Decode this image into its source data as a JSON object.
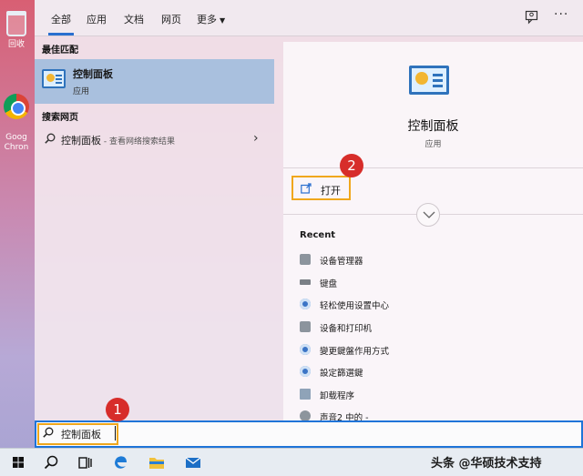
{
  "desktop": {
    "icons": [
      {
        "label": "回收",
        "icon": "recycle-bin-icon"
      },
      {
        "label": "Goog\nChron",
        "icon": "chrome-icon"
      }
    ]
  },
  "tabs": [
    {
      "label": "全部",
      "active": true
    },
    {
      "label": "应用",
      "active": false
    },
    {
      "label": "文档",
      "active": false
    },
    {
      "label": "网页",
      "active": false
    },
    {
      "label": "更多",
      "active": false
    }
  ],
  "left": {
    "best_match_heading": "最佳匹配",
    "best_match": {
      "title": "控制面板",
      "subtitle": "应用"
    },
    "web_heading": "搜索网页",
    "web_result": {
      "title": "控制面板",
      "subtitle": " - 查看网络搜索结果"
    }
  },
  "right": {
    "title": "控制面板",
    "subtitle": "应用",
    "open_label": "打开",
    "recent_heading": "Recent",
    "recent": [
      {
        "label": "设备管理器",
        "icon": "device-manager-icon"
      },
      {
        "label": "键盘",
        "icon": "keyboard-icon"
      },
      {
        "label": "轻松使用设置中心",
        "icon": "ease-of-access-icon"
      },
      {
        "label": "设备和打印机",
        "icon": "printer-icon"
      },
      {
        "label": "變更鍵盤作用方式",
        "icon": "ease-of-access-icon"
      },
      {
        "label": "設定篩選鍵",
        "icon": "ease-of-access-icon"
      },
      {
        "label": "卸载程序",
        "icon": "uninstall-icon"
      },
      {
        "label": "声音2 中的 -",
        "icon": "audio-icon"
      }
    ]
  },
  "annotations": {
    "badge_1": "1",
    "badge_2": "2"
  },
  "search": {
    "value": "控制面板"
  },
  "taskbar": {
    "watermark": "头条 @华硕技术支持"
  },
  "colors": {
    "highlight": "#f0a71c",
    "badge": "#d72d2a",
    "accent": "#1f74d8",
    "selection": "#a9c0de"
  }
}
